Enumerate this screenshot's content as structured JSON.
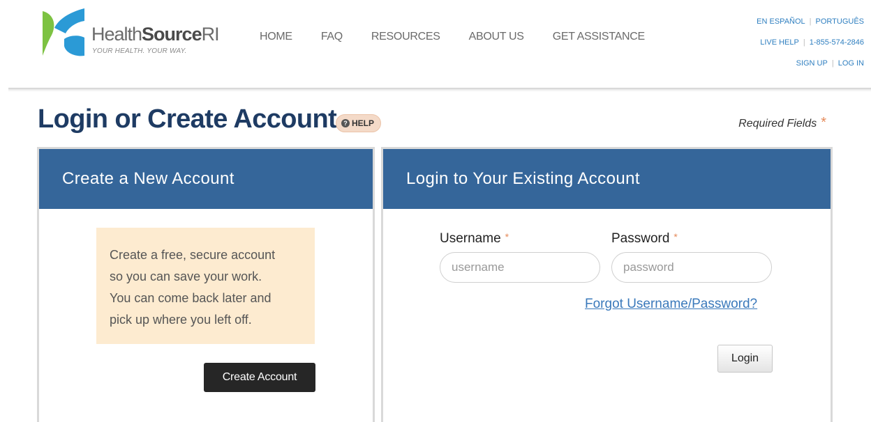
{
  "header": {
    "brand_light": "Health",
    "brand_bold": "Source",
    "brand_suffix": "RI",
    "tagline": "YOUR HEALTH. YOUR WAY.",
    "logo_icon": "healthsource-leaf-logo",
    "nav": [
      "HOME",
      "FAQ",
      "RESOURCES",
      "ABOUT US",
      "GET ASSISTANCE"
    ],
    "util": {
      "espanol": "EN ESPAÑOL",
      "portugues": "PORTUGUÊS",
      "live_help": "LIVE HELP",
      "phone": "1-855-574-2846",
      "sign_up": "SIGN UP",
      "log_in": "LOG IN"
    }
  },
  "page": {
    "title": "Login or Create Account",
    "help_label": "HELP",
    "help_icon": "question-circle-icon",
    "required_note": "Required Fields",
    "required_star": "*"
  },
  "create_panel": {
    "heading": "Create a New Account",
    "info_lines": [
      "Create a free, secure account",
      "so you can save your work.",
      "You can come back later and",
      "pick up where you left off."
    ],
    "button": "Create Account"
  },
  "login_panel": {
    "heading": "Login to Your Existing Account",
    "username_label": "Username",
    "username_placeholder": "username",
    "password_label": "Password",
    "password_placeholder": "password",
    "forgot": "Forgot Username/Password?",
    "button": "Login"
  },
  "colors": {
    "navy_title": "#1e3b63",
    "panel_header": "#35669a",
    "info_box": "#fdebd0",
    "link": "#3a79bb",
    "required_star": "#e58a5a",
    "logo_green": "#7dc242",
    "logo_blue": "#2b9ad6"
  }
}
